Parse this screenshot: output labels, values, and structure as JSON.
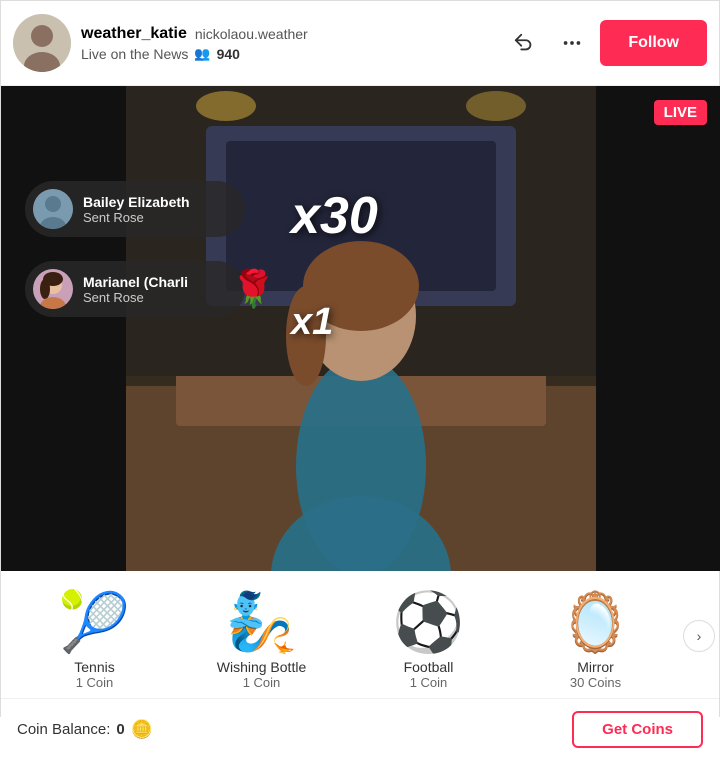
{
  "header": {
    "username": "weather_katie",
    "display_name": "nickolaou.weather",
    "live_label": "Live on the News",
    "viewers_icon": "👥",
    "viewer_count": "940",
    "share_icon": "share",
    "more_icon": "more",
    "follow_label": "Follow"
  },
  "video": {
    "live_badge": "LIVE",
    "x30_text": "x30",
    "x1_text": "x1",
    "toast1": {
      "name": "Bailey Elizabeth",
      "action": "Sent Rose"
    },
    "toast2": {
      "name": "Marianel (Charli",
      "action": "Sent Rose"
    }
  },
  "gifts": [
    {
      "emoji": "🎾",
      "name": "Tennis",
      "cost": "1 Coin"
    },
    {
      "emoji": "🧞",
      "name": "Wishing Bottle",
      "cost": "1 Coin"
    },
    {
      "emoji": "⚽",
      "name": "Football",
      "cost": "1 Coin"
    },
    {
      "emoji": "🪞",
      "name": "Mirror",
      "cost": "30 Coins"
    }
  ],
  "coin_bar": {
    "label": "Coin Balance:",
    "count": "0",
    "coin_icon": "🪙",
    "get_coins_label": "Get Coins"
  },
  "scroll_arrow": "›"
}
